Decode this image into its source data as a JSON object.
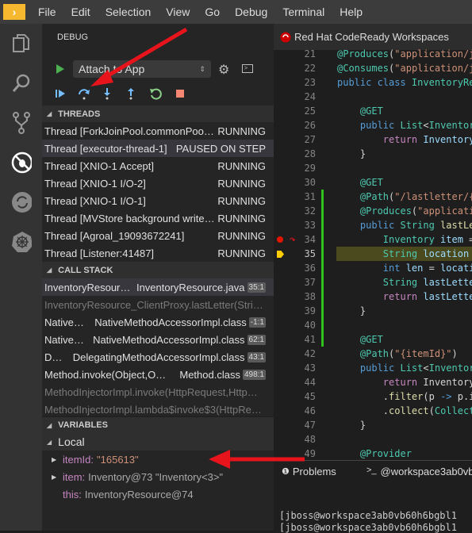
{
  "menu": [
    "File",
    "Edit",
    "Selection",
    "View",
    "Go",
    "Debug",
    "Terminal",
    "Help"
  ],
  "activity_icons": [
    "files-icon",
    "search-icon",
    "source-control-icon",
    "debug-icon",
    "sync-icon",
    "kubernetes-icon"
  ],
  "debug": {
    "title": "DEBUG",
    "config": "Attach to App",
    "toolbar": [
      "continue-icon",
      "step-over-icon",
      "step-into-icon",
      "step-out-icon",
      "restart-icon",
      "stop-icon"
    ]
  },
  "threads": {
    "header": "THREADS",
    "items": [
      {
        "name": "Thread [ForkJoinPool.commonPoo…",
        "status": "RUNNING"
      },
      {
        "name": "Thread [executor-thread-1]",
        "status": "PAUSED ON STEP"
      },
      {
        "name": "Thread [XNIO-1 Accept]",
        "status": "RUNNING"
      },
      {
        "name": "Thread [XNIO-1 I/O-2]",
        "status": "RUNNING"
      },
      {
        "name": "Thread [XNIO-1 I/O-1]",
        "status": "RUNNING"
      },
      {
        "name": "Thread [MVStore background write…",
        "status": "RUNNING"
      },
      {
        "name": "Thread [Agroal_19093672241]",
        "status": "RUNNING"
      },
      {
        "name": "Thread [Listener:41487]",
        "status": "RUNNING"
      }
    ]
  },
  "callstack": {
    "header": "CALL STACK",
    "items": [
      {
        "name": "InventoryResour…",
        "file": "InventoryResource.java",
        "pos": "35:1"
      },
      {
        "name": "InventoryResource_ClientProxy.lastLetter(Stri…",
        "file": "",
        "pos": "",
        "dim": true
      },
      {
        "name": "Native…",
        "file": "NativeMethodAccessorImpl.class",
        "pos": "-1:1"
      },
      {
        "name": "Native…",
        "file": "NativeMethodAccessorImpl.class",
        "pos": "62:1"
      },
      {
        "name": "D…",
        "file": "DelegatingMethodAccessorImpl.class",
        "pos": "43:1"
      },
      {
        "name": "Method.invoke(Object,O…",
        "file": "Method.class",
        "pos": "498:1"
      },
      {
        "name": "MethodInjectorImpl.invoke(HttpRequest,Http…",
        "file": "",
        "pos": "",
        "dim": true
      },
      {
        "name": "MethodInjectorImpl.lambda$invoke$3(HttpRe…",
        "file": "",
        "pos": "",
        "dim": true
      }
    ]
  },
  "variables": {
    "header": "VARIABLES",
    "scope": "Local",
    "items": [
      {
        "name": "itemId:",
        "value": "\"165613\"",
        "expandable": true,
        "string": true
      },
      {
        "name": "item:",
        "value": "Inventory@73 \"Inventory<3>\"",
        "expandable": true
      },
      {
        "name": "this:",
        "value": "InventoryResource@74",
        "expandable": false
      }
    ]
  },
  "editor": {
    "tab": "Red Hat CodeReady Workspaces",
    "current_line": 35,
    "breakpoint_line": 34,
    "lines": [
      {
        "n": 21,
        "t": [
          [
            "@Produces",
            "ann"
          ],
          [
            "(",
            "txt"
          ],
          [
            "\"application/j",
            "str"
          ]
        ]
      },
      {
        "n": 22,
        "t": [
          [
            "@Consumes",
            "ann"
          ],
          [
            "(",
            "txt"
          ],
          [
            "\"application/j",
            "str"
          ]
        ]
      },
      {
        "n": 23,
        "t": [
          [
            "public class ",
            "kw"
          ],
          [
            "InventoryRe",
            "type"
          ]
        ]
      },
      {
        "n": 24,
        "t": []
      },
      {
        "n": 25,
        "t": [
          [
            "    @GET",
            "ann"
          ]
        ]
      },
      {
        "n": 26,
        "t": [
          [
            "    public ",
            "kw"
          ],
          [
            "List",
            "type"
          ],
          [
            "<",
            "txt"
          ],
          [
            "Inventor",
            "type"
          ]
        ]
      },
      {
        "n": 27,
        "t": [
          [
            "        return ",
            "ctl"
          ],
          [
            "Inventory",
            "var"
          ]
        ]
      },
      {
        "n": 28,
        "t": [
          [
            "    }",
            "txt"
          ]
        ]
      },
      {
        "n": 29,
        "t": []
      },
      {
        "n": 30,
        "t": [
          [
            "    @GET",
            "ann"
          ]
        ]
      },
      {
        "n": 31,
        "t": [
          [
            "    @Path",
            "ann"
          ],
          [
            "(",
            "txt"
          ],
          [
            "\"/lastletter/{",
            "str"
          ]
        ]
      },
      {
        "n": 32,
        "t": [
          [
            "    @Produces",
            "ann"
          ],
          [
            "(",
            "txt"
          ],
          [
            "\"applicati",
            "str"
          ]
        ]
      },
      {
        "n": 33,
        "t": [
          [
            "    public ",
            "kw"
          ],
          [
            "String ",
            "type"
          ],
          [
            "lastLe",
            "fn"
          ]
        ]
      },
      {
        "n": 34,
        "t": [
          [
            "        Inventory ",
            "type"
          ],
          [
            "item",
            "var"
          ],
          [
            " =",
            "txt"
          ]
        ]
      },
      {
        "n": 35,
        "t": [
          [
            "        String ",
            "type"
          ],
          [
            "location",
            "var"
          ]
        ]
      },
      {
        "n": 36,
        "t": [
          [
            "        int ",
            "kw"
          ],
          [
            "len",
            "var"
          ],
          [
            " = ",
            "txt"
          ],
          [
            "locati",
            "var"
          ]
        ]
      },
      {
        "n": 37,
        "t": [
          [
            "        String ",
            "type"
          ],
          [
            "lastLette",
            "var"
          ]
        ]
      },
      {
        "n": 38,
        "t": [
          [
            "        return ",
            "ctl"
          ],
          [
            "lastLette",
            "var"
          ]
        ]
      },
      {
        "n": 39,
        "t": [
          [
            "    }",
            "txt"
          ]
        ]
      },
      {
        "n": 40,
        "t": []
      },
      {
        "n": 41,
        "t": [
          [
            "    @GET",
            "ann"
          ]
        ]
      },
      {
        "n": 42,
        "t": [
          [
            "    @Path",
            "ann"
          ],
          [
            "(",
            "txt"
          ],
          [
            "\"{itemId}\"",
            "str"
          ],
          [
            ")",
            "txt"
          ]
        ]
      },
      {
        "n": 43,
        "t": [
          [
            "    public ",
            "kw"
          ],
          [
            "List",
            "type"
          ],
          [
            "<",
            "txt"
          ],
          [
            "Inventor",
            "type"
          ]
        ]
      },
      {
        "n": 44,
        "t": [
          [
            "        return ",
            "ctl"
          ],
          [
            "Inventory",
            "txt"
          ]
        ]
      },
      {
        "n": 45,
        "t": [
          [
            "        .",
            "txt"
          ],
          [
            "filter",
            "fn"
          ],
          [
            "(p ",
            "txt"
          ],
          [
            "->",
            "kw"
          ],
          [
            " p.i",
            "txt"
          ]
        ]
      },
      {
        "n": 46,
        "t": [
          [
            "        .",
            "txt"
          ],
          [
            "collect",
            "fn"
          ],
          [
            "(",
            "txt"
          ],
          [
            "Collect",
            "type"
          ]
        ]
      },
      {
        "n": 47,
        "t": [
          [
            "    }",
            "txt"
          ]
        ]
      },
      {
        "n": 48,
        "t": []
      },
      {
        "n": 49,
        "t": [
          [
            "    @Provider",
            "ann"
          ]
        ]
      }
    ]
  },
  "panel": {
    "tabs": [
      {
        "icon": "alert-icon",
        "label": "Problems"
      },
      {
        "icon": "terminal-icon",
        "label": "@workspace3ab0vb"
      }
    ],
    "terminal": [
      "[jboss@workspace3ab0vb60h6bgbl1",
      "[jboss@workspace3ab0vb60h6bgbl1"
    ]
  },
  "colors": {
    "accent": "#f5b82e",
    "annotation_arrow": "#e8141c",
    "current_line": "#4b4a1f",
    "modified_gutter": "#2ec21b"
  }
}
